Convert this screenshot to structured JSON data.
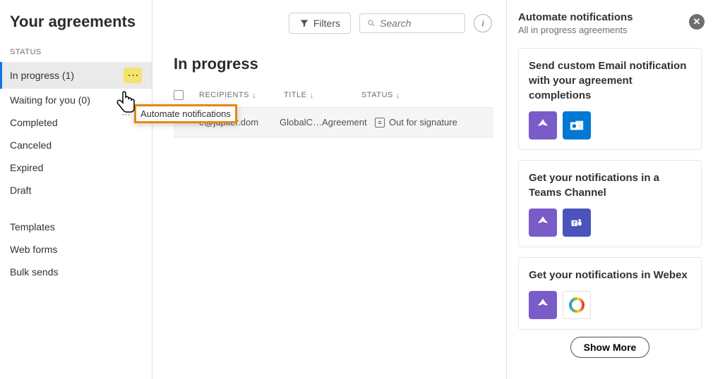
{
  "page": {
    "title": "Your agreements",
    "status_label": "STATUS"
  },
  "sidebar": {
    "items": [
      {
        "label": "In progress (1)"
      },
      {
        "label": "Waiting for you (0)"
      },
      {
        "label": "Completed"
      },
      {
        "label": "Canceled"
      },
      {
        "label": "Expired"
      },
      {
        "label": "Draft"
      },
      {
        "label": "Templates"
      },
      {
        "label": "Web forms"
      },
      {
        "label": "Bulk sends"
      }
    ]
  },
  "popup": {
    "label": "Automate notifications",
    "caret": "⋯"
  },
  "toolbar": {
    "filters": "Filters",
    "search_placeholder": "Search"
  },
  "section": {
    "heading": "In progress"
  },
  "columns": {
    "recipients": "RECIPIENTS",
    "title": "TITLE",
    "status": "STATUS"
  },
  "row": {
    "recipient": "e@jupiter.dom",
    "title": "GlobalC…",
    "type": "Agreement",
    "status": "Out for signature"
  },
  "panel": {
    "title": "Automate notifications",
    "subtitle": "All in progress agreements",
    "cards": [
      {
        "title": "Send custom Email notification with your agreement completions"
      },
      {
        "title": "Get your notifications in a Teams Channel"
      },
      {
        "title": "Get your notifications in Webex"
      }
    ],
    "show_more": "Show More"
  }
}
